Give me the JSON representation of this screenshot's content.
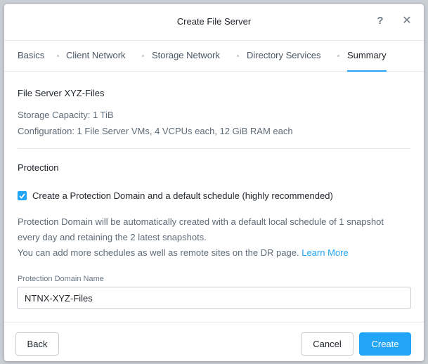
{
  "dialog": {
    "title": "Create File Server"
  },
  "tabs": [
    {
      "label": "Basics"
    },
    {
      "label": "Client Network"
    },
    {
      "label": "Storage Network"
    },
    {
      "label": "Directory Services"
    },
    {
      "label": "Summary"
    }
  ],
  "active_tab": "Summary",
  "summary": {
    "server_title": "File Server XYZ-Files",
    "storage_capacity": "Storage Capacity: 1 TiB",
    "configuration": "Configuration: 1 File Server VMs, 4 VCPUs each, 12 GiB RAM each"
  },
  "protection": {
    "title": "Protection",
    "checkbox_label": "Create a Protection Domain and a default schedule (highly recommended)",
    "checked": true,
    "desc_line1": "Protection Domain will be automatically created with a default local schedule of 1 snapshot",
    "desc_line2": "every day and retaining the 2 latest snapshots.",
    "desc_line3": "You can add more schedules as well as remote sites on the DR page.",
    "learn_more": "Learn More",
    "field_label": "Protection Domain Name",
    "field_value": "NTNX-XYZ-Files"
  },
  "footer": {
    "back": "Back",
    "cancel": "Cancel",
    "create": "Create"
  },
  "colors": {
    "accent": "#22a5f7"
  }
}
